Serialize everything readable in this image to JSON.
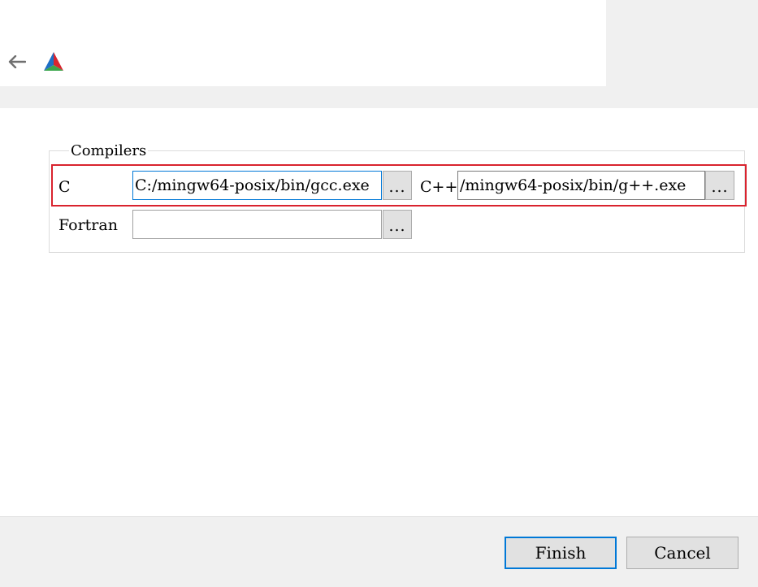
{
  "header": {
    "back_icon": "arrow-left-icon",
    "logo_icon": "cmake-logo-icon"
  },
  "compilers": {
    "group_title": "Compilers",
    "c_label": "C",
    "c_value": "C:/mingw64-posix/bin/gcc.exe",
    "cpp_label": "C++",
    "cpp_value": "/mingw64-posix/bin/g++.exe",
    "fortran_label": "Fortran",
    "fortran_value": "",
    "browse_label": "..."
  },
  "footer": {
    "finish_label": "Finish",
    "cancel_label": "Cancel"
  },
  "colors": {
    "highlight": "#d9232e",
    "focus": "#0078d7"
  }
}
